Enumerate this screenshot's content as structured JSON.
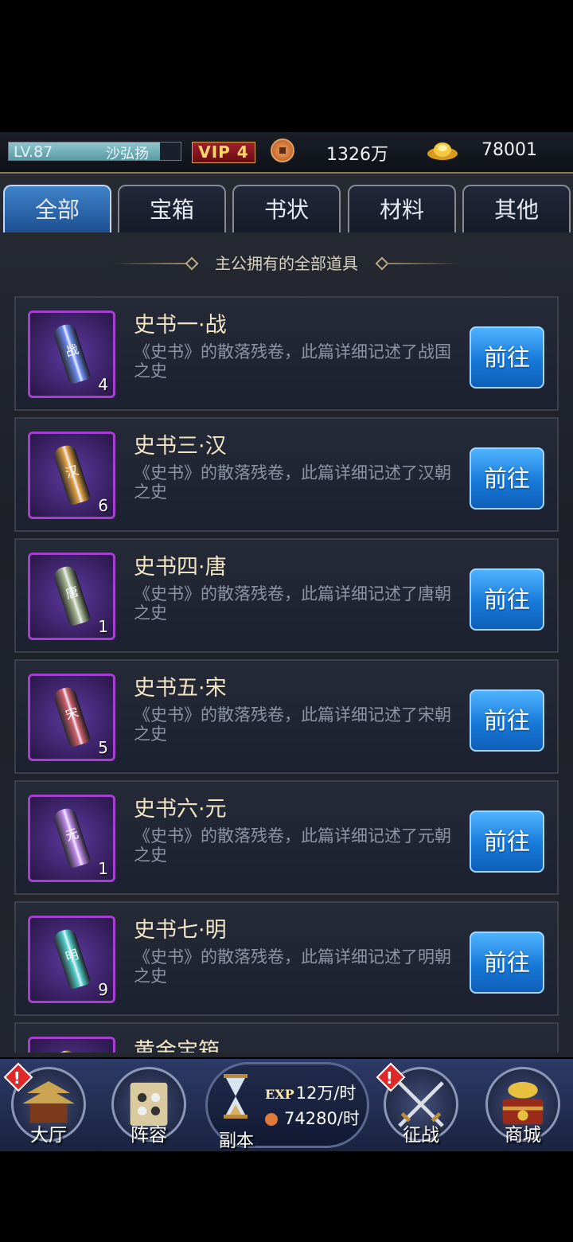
{
  "status": {
    "level": "LV.87",
    "level_progress": 0.88,
    "player_name": "沙弘扬",
    "vip": "VIP 4",
    "copper": "1326万",
    "gold": "78001"
  },
  "tabs": [
    {
      "label": "全部",
      "active": true
    },
    {
      "label": "宝箱",
      "active": false
    },
    {
      "label": "书状",
      "active": false
    },
    {
      "label": "材料",
      "active": false
    },
    {
      "label": "其他",
      "active": false
    }
  ],
  "subtitle": "主公拥有的全部道具",
  "go_label": "前往",
  "items": [
    {
      "name": "史书一·战",
      "desc": "《史书》的散落残卷，此篇详细记述了战国之史",
      "qty": "4",
      "glyph": "战",
      "color": "#6d8cf0"
    },
    {
      "name": "史书三·汉",
      "desc": "《史书》的散落残卷，此篇详细记述了汉朝之史",
      "qty": "6",
      "glyph": "汉",
      "color": "#e0a040"
    },
    {
      "name": "史书四·唐",
      "desc": "《史书》的散落残卷，此篇详细记述了唐朝之史",
      "qty": "1",
      "glyph": "唐",
      "color": "#a8b890"
    },
    {
      "name": "史书五·宋",
      "desc": "《史书》的散落残卷，此篇详细记述了宋朝之史",
      "qty": "5",
      "glyph": "宋",
      "color": "#d0606a"
    },
    {
      "name": "史书六·元",
      "desc": "《史书》的散落残卷，此篇详细记述了元朝之史",
      "qty": "1",
      "glyph": "元",
      "color": "#c08ae8"
    },
    {
      "name": "史书七·明",
      "desc": "《史书》的散落残卷，此篇详细记述了明朝之史",
      "qty": "9",
      "glyph": "明",
      "color": "#50d0c8"
    },
    {
      "name": "黄金宝箱",
      "desc": "",
      "qty": "",
      "glyph": "",
      "color": "#e0a040"
    }
  ],
  "nav": {
    "hall": "大厅",
    "lineup": "阵容",
    "dungeon": "副本",
    "exp_tag": "EXP",
    "exp_rate": "12万/时",
    "copper_rate": "74280/时",
    "campaign": "征战",
    "shop": "商城",
    "alert_mark": "!"
  }
}
